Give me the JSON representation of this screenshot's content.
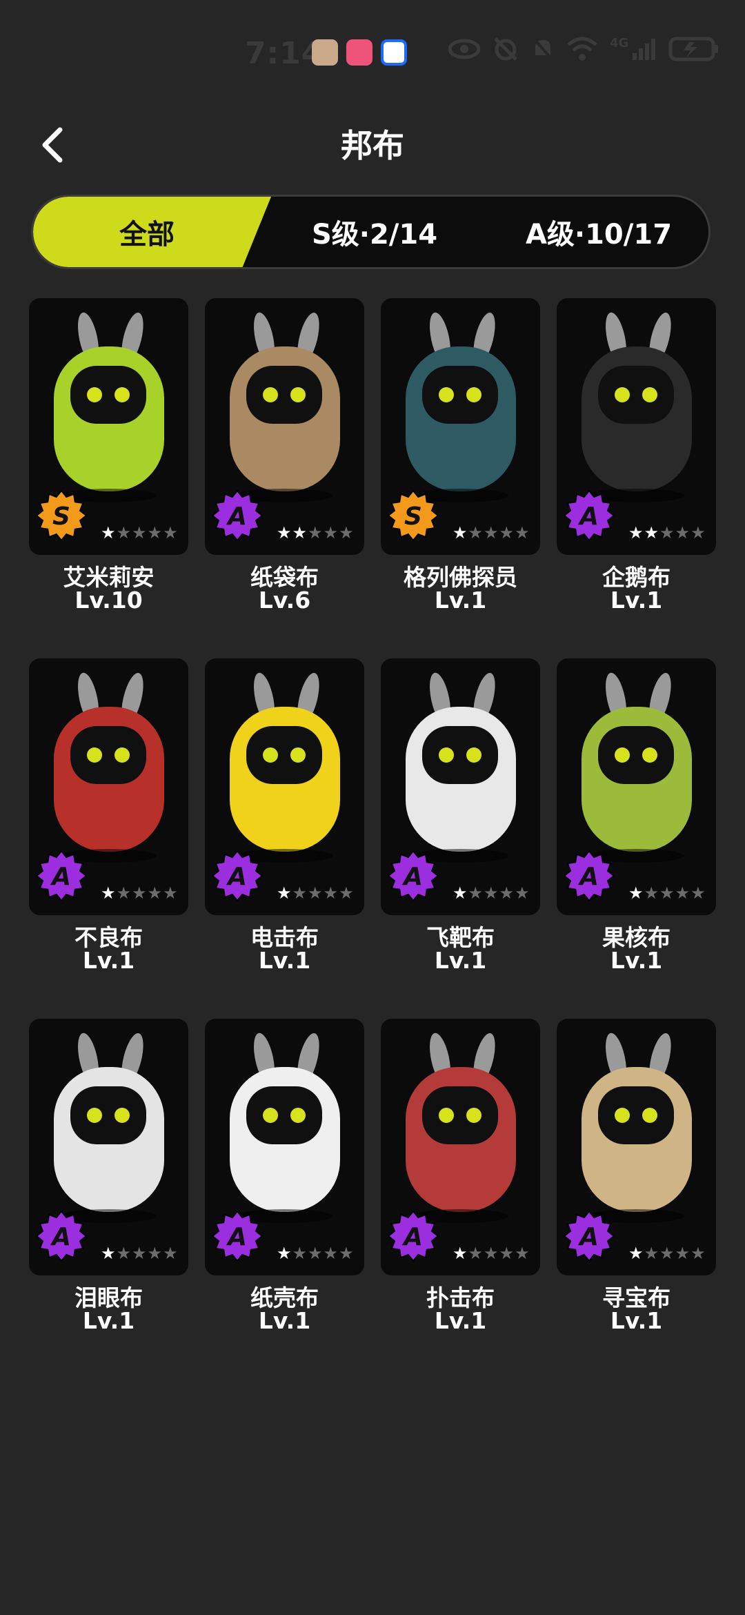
{
  "status": {
    "time": "7:14",
    "network": "4G"
  },
  "header": {
    "title": "邦布"
  },
  "tabs": [
    {
      "label": "全部"
    },
    {
      "label": "S级·2/14"
    },
    {
      "label": "A级·10/17"
    }
  ],
  "colors": {
    "accent": "#cddb1b",
    "rank_s": "#f39a1a",
    "rank_a": "#9b2fe0"
  },
  "bangboo": [
    {
      "name": "艾米莉安",
      "level": "Lv.10",
      "rank": "S",
      "stars": 1,
      "color": "#a8d12a"
    },
    {
      "name": "纸袋布",
      "level": "Lv.6",
      "rank": "A",
      "stars": 2,
      "color": "#a98a62"
    },
    {
      "name": "格列佛探员",
      "level": "Lv.1",
      "rank": "S",
      "stars": 1,
      "color": "#2e5b63"
    },
    {
      "name": "企鹅布",
      "level": "Lv.1",
      "rank": "A",
      "stars": 2,
      "color": "#2a2a2a"
    },
    {
      "name": "不良布",
      "level": "Lv.1",
      "rank": "A",
      "stars": 1,
      "color": "#b8302a"
    },
    {
      "name": "电击布",
      "level": "Lv.1",
      "rank": "A",
      "stars": 1,
      "color": "#f0d21a"
    },
    {
      "name": "飞靶布",
      "level": "Lv.1",
      "rank": "A",
      "stars": 1,
      "color": "#e8e8e8"
    },
    {
      "name": "果核布",
      "level": "Lv.1",
      "rank": "A",
      "stars": 1,
      "color": "#9cbb3a"
    },
    {
      "name": "泪眼布",
      "level": "Lv.1",
      "rank": "A",
      "stars": 1,
      "color": "#e4e4e4"
    },
    {
      "name": "纸壳布",
      "level": "Lv.1",
      "rank": "A",
      "stars": 1,
      "color": "#efefef"
    },
    {
      "name": "扑击布",
      "level": "Lv.1",
      "rank": "A",
      "stars": 1,
      "color": "#b53a3a"
    },
    {
      "name": "寻宝布",
      "level": "Lv.1",
      "rank": "A",
      "stars": 1,
      "color": "#cfb486"
    }
  ]
}
